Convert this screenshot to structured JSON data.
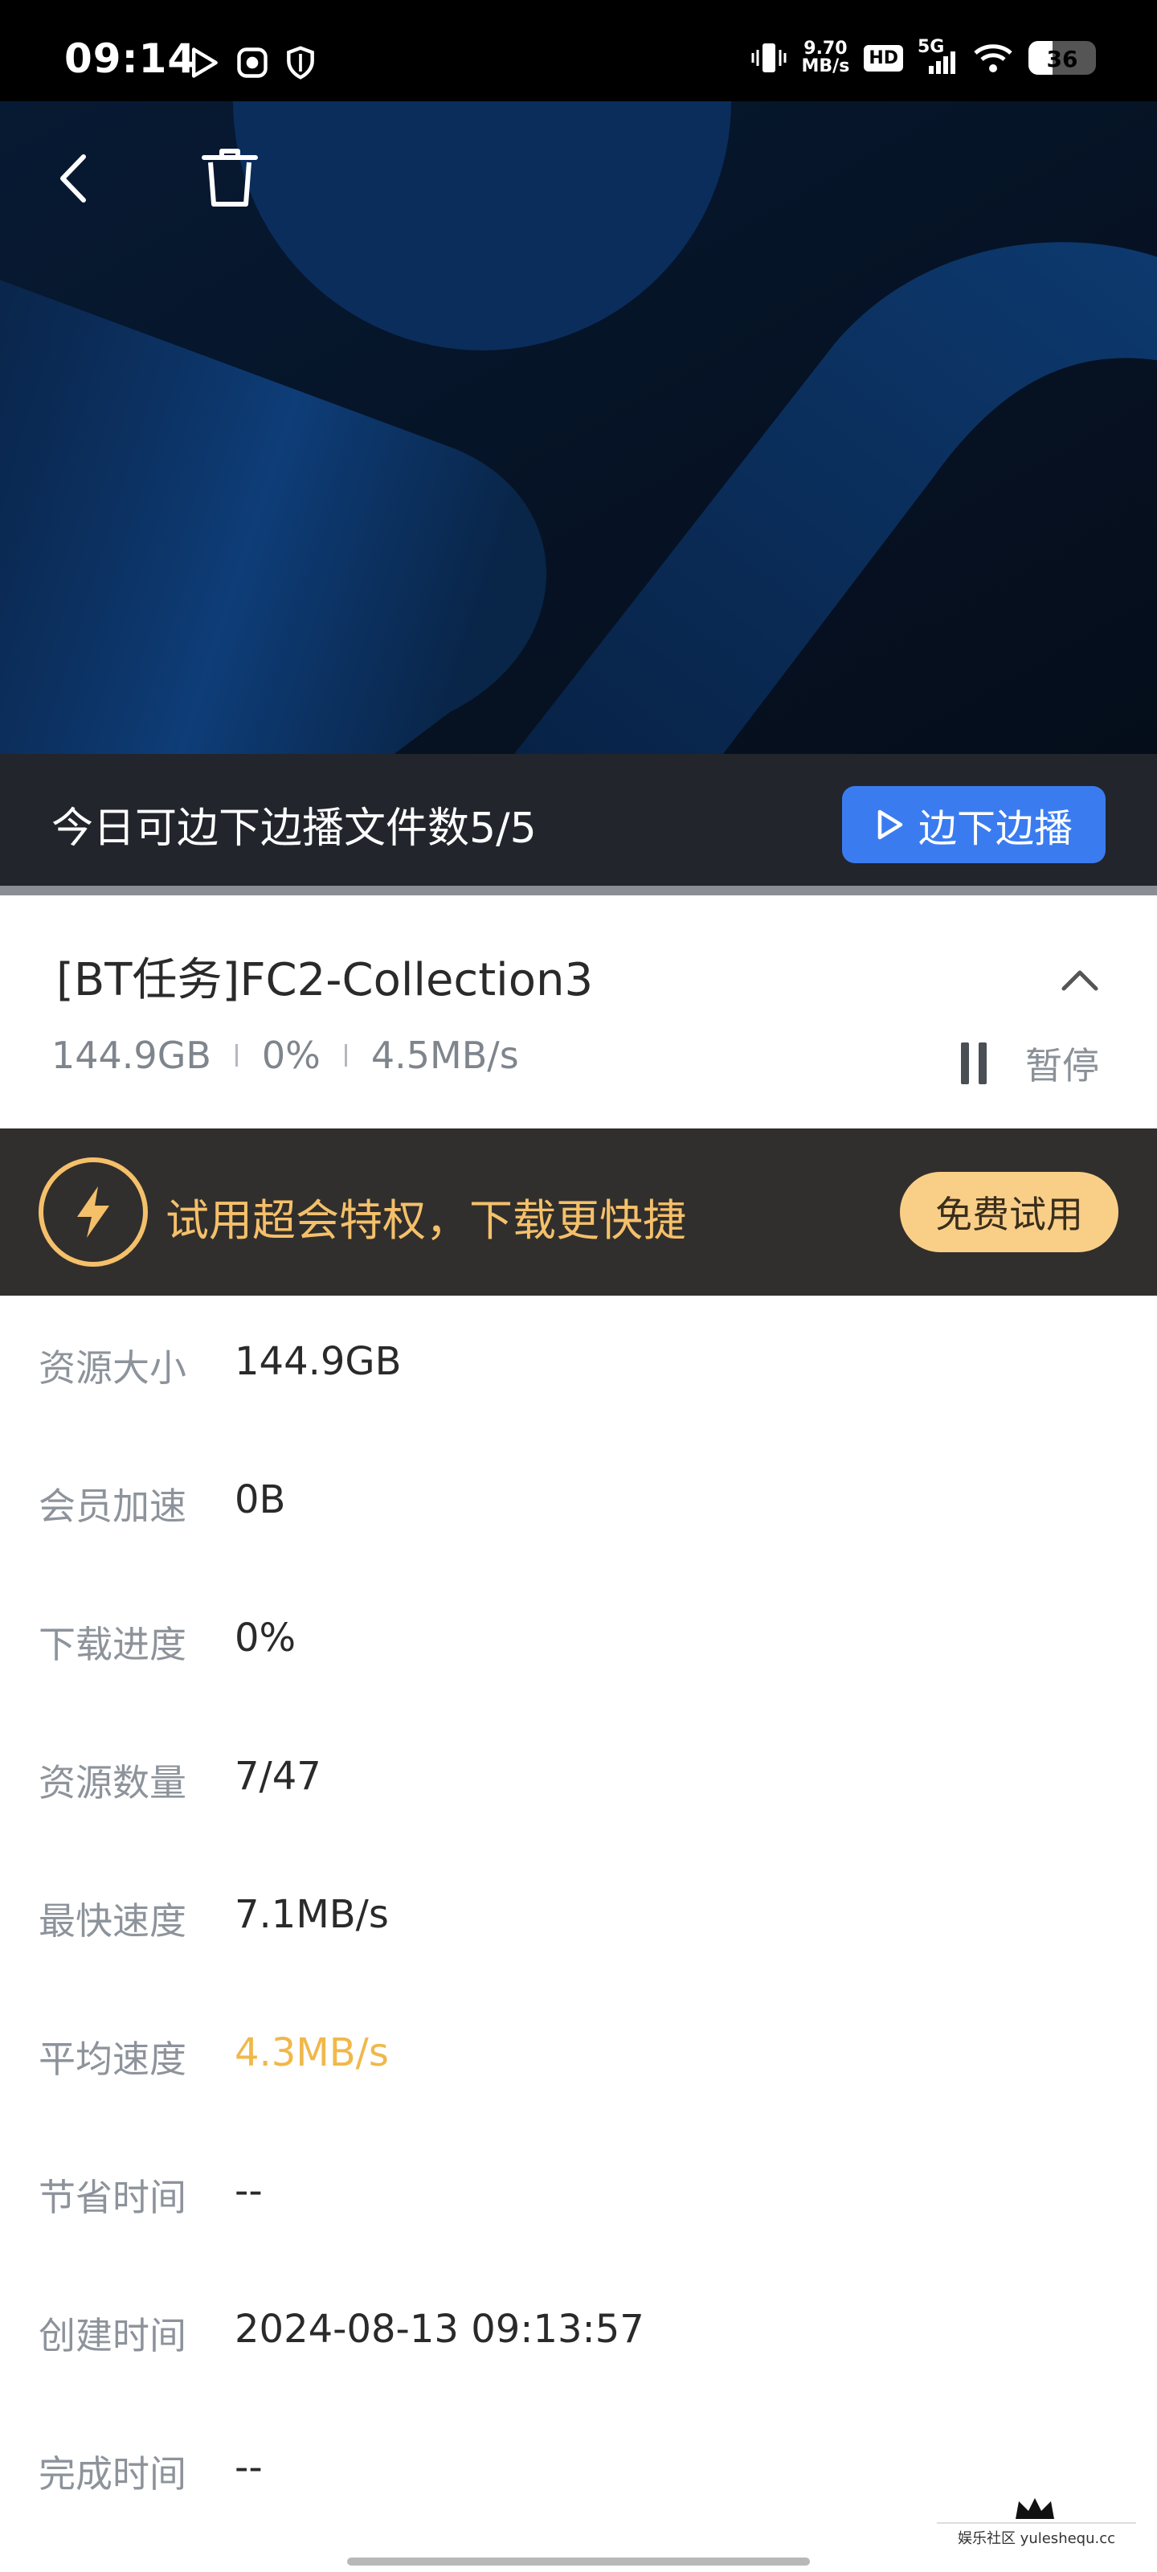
{
  "status_bar": {
    "time": "09:14",
    "net_speed_value": "9.70",
    "net_speed_unit": "MB/s",
    "hd_label": "HD",
    "network_label": "5G",
    "battery": "36",
    "battery_level": 0.36
  },
  "play_bar": {
    "quota_text": "今日可边下边播文件数5/5",
    "play_label": "边下边播"
  },
  "task": {
    "title": "[BT任务]FC2-Collection3",
    "size": "144.9GB",
    "progress": "0%",
    "speed": "4.5MB/s",
    "pause_label": "暂停"
  },
  "promo": {
    "text": "试用超会特权，下载更快捷",
    "button_label": "免费试用"
  },
  "details": [
    {
      "label": "资源大小",
      "value": "144.9GB"
    },
    {
      "label": "会员加速",
      "value": "0B"
    },
    {
      "label": "下载进度",
      "value": "0%"
    },
    {
      "label": "资源数量",
      "value": "7/47"
    },
    {
      "label": "最快速度",
      "value": "7.1MB/s"
    },
    {
      "label": "平均速度",
      "value": "4.3MB/s",
      "highlight_color": "#f0b84a"
    },
    {
      "label": "节省时间",
      "value": "--"
    },
    {
      "label": "创建时间",
      "value": "2024-08-13 09:13:57"
    },
    {
      "label": "完成时间",
      "value": "--"
    }
  ],
  "watermark": {
    "text": "娱乐社区 yuleshequ.cc"
  },
  "colors": {
    "accent_blue": "#3a7cf0",
    "gold": "#f5c06a",
    "promo_button": "#f9cf88",
    "dark_bar": "#22252c"
  }
}
